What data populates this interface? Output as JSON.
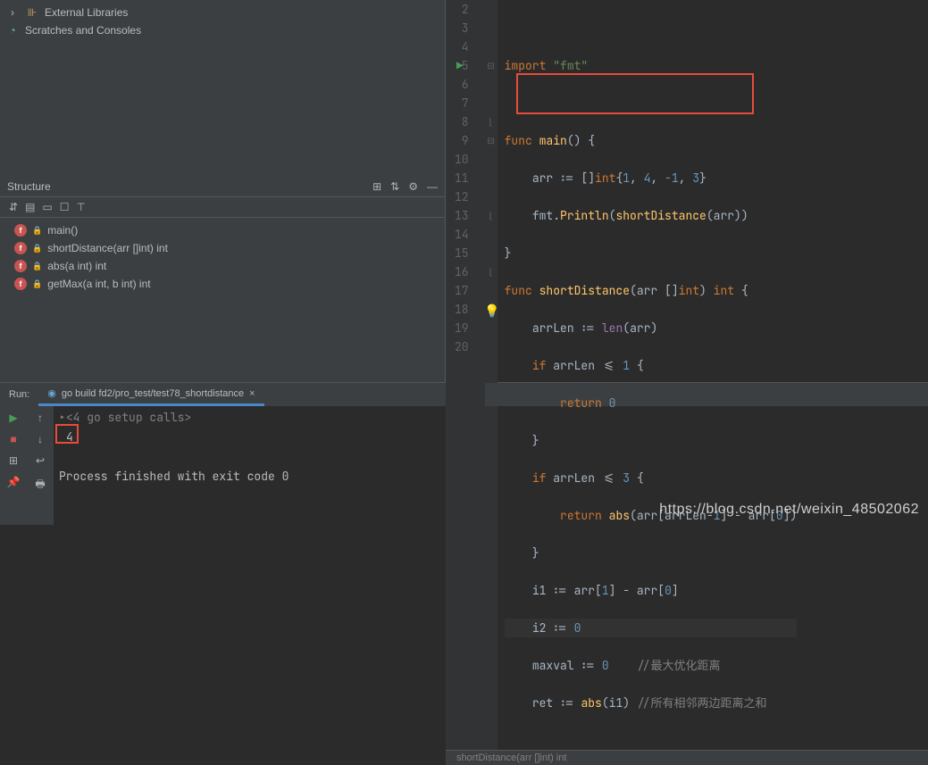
{
  "project": {
    "external_libraries": "External Libraries",
    "scratches": "Scratches and Consoles"
  },
  "structure": {
    "title": "Structure",
    "items": [
      {
        "label": "main()"
      },
      {
        "label": "shortDistance(arr []int) int"
      },
      {
        "label": "abs(a int) int"
      },
      {
        "label": "getMax(a int, b int) int"
      }
    ]
  },
  "editor": {
    "breadcrumb": "shortDistance(arr []int) int",
    "lines": {
      "2": "",
      "3": "import \"fmt\"",
      "4": "",
      "5": "func main() {",
      "6": "    arr := []int{1, 4, -1, 3}",
      "7": "    fmt.Println(shortDistance(arr))",
      "8": "}",
      "9": "func shortDistance(arr []int) int {",
      "10": "    arrLen := len(arr)",
      "11": "    if arrLen <= 1 {",
      "12": "        return 0",
      "13": "    }",
      "14": "    if arrLen <= 3 {",
      "15": "        return abs(arr[arrLen-1] - arr[0])",
      "16": "    }",
      "17": "    i1 := arr[1] - arr[0]",
      "18": "    i2 := 0",
      "19": "    maxval := 0    //最大优化距离",
      "20": "    ret := abs(i1) //所有相邻两边距离之和"
    }
  },
  "run": {
    "label": "Run:",
    "tab": "go build fd2/pro_test/test78_shortdistance",
    "console": {
      "setup": "<4 go setup calls>",
      "output": "4",
      "exit": "Process finished with exit code 0"
    }
  },
  "watermark": "https://blog.csdn.net/weixin_48502062"
}
